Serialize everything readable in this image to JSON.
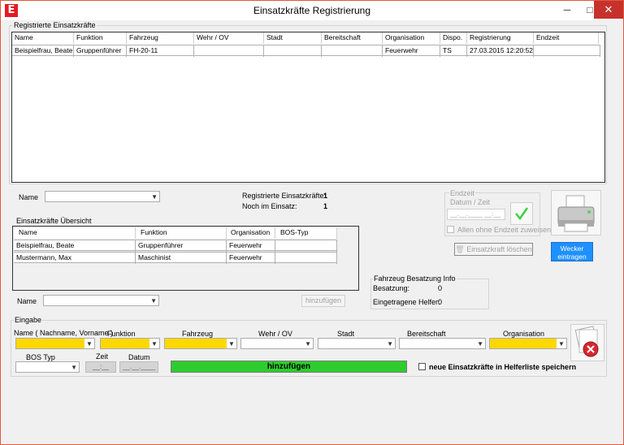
{
  "window": {
    "title": "Einsatzkräfte Registrierung",
    "logo_letter": "E",
    "controls": {
      "minimize": "─",
      "maximize": "□",
      "close": "✕"
    }
  },
  "registered": {
    "group_label": "Registrierte Einsatzkräfte",
    "columns": [
      "Name",
      "Funktion",
      "Fahrzeug",
      "Wehr / OV",
      "Stadt",
      "Bereitschaft",
      "Organisation",
      "Dispo.",
      "Registrierung",
      "Endzeit"
    ],
    "rows": [
      [
        "Beispielfrau, Beate",
        "Gruppenführer",
        "FH-20-11",
        "",
        "",
        "",
        "Feuerwehr",
        "TS",
        "27.03.2015 12:20:52",
        ""
      ]
    ]
  },
  "filter": {
    "name_label": "Name",
    "name_value": ""
  },
  "stats": {
    "registered_label": "Registrierte Einsatzkräfte:",
    "registered_count": "1",
    "in_action_label": "Noch im Einsatz:",
    "in_action_count": "1"
  },
  "endzeit": {
    "group_label": "Endzeit",
    "sub_label": "Datum / Zeit",
    "datetime_value": "__.__.____ __:__",
    "checkbox_label": "Allen ohne Endzeit zuweisen"
  },
  "delete_button": "Einsatzkraft löschen",
  "alarm_button": "Wecker eintragen",
  "overview": {
    "group_label": "Einsatzkräfte Übersicht",
    "columns": [
      "Name",
      "Funktion",
      "Organisation",
      "BOS-Typ"
    ],
    "rows": [
      [
        "Beispielfrau, Beate",
        "Gruppenführer",
        "Feuerwehr",
        ""
      ],
      [
        "Mustermann, Max",
        "Maschinist",
        "Feuerwehr",
        ""
      ]
    ]
  },
  "add_row": {
    "name_label": "Name",
    "name_value": "",
    "add_button": "hinzufügen"
  },
  "vehicle_info": {
    "group_label": "Fahrzeug Besatzung Info",
    "crew_label": "Besatzung:",
    "crew_value": "0",
    "helpers_label": "Eingetragene Helfer:",
    "helpers_value": "0"
  },
  "input": {
    "group_label": "Eingabe",
    "labels": {
      "name": "Name ( Nachname, Vorname )",
      "function": "Funktion",
      "vehicle": "Fahrzeug",
      "wehr": "Wehr / OV",
      "stadt": "Stadt",
      "bereitschaft": "Bereitschaft",
      "organisation": "Organisation",
      "bos": "BOS  Typ",
      "zeit": "Zeit",
      "datum": "Datum"
    },
    "time_value": "__:__",
    "date_value": "__.__.____",
    "add_button": "hinzufügen",
    "save_checkbox_label": "neue Einsatzkräfte in Helferliste speichern"
  },
  "colors": {
    "required_field": "#ffd800",
    "add_button_green": "#2ecc2e",
    "alarm_button_blue": "#1e90ff",
    "close_red": "#c7312b",
    "logo_red": "#e31b23"
  }
}
